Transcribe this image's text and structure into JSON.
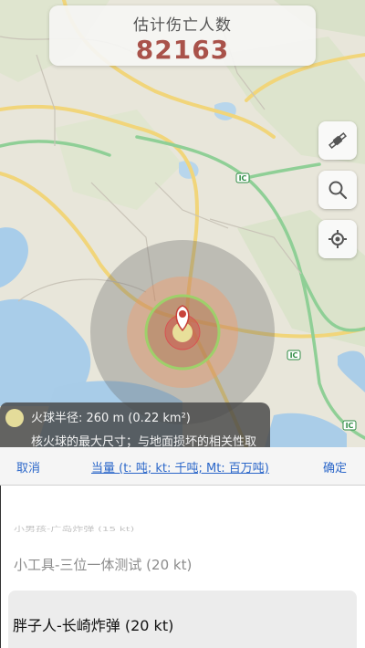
{
  "casualties": {
    "label": "估计伤亡人数",
    "value": "82163"
  },
  "map": {
    "highway_badges": [
      "IC",
      "IC",
      "IC"
    ],
    "colors": {
      "fireball": "#e4dc9a",
      "heavy_blast": "#e9a257",
      "thermal": "#ffa07a",
      "light_blast": "#8a8a8a",
      "radiation": "#9ec96a"
    }
  },
  "map_buttons": [
    "satellite-icon",
    "search-icon",
    "locate-icon"
  ],
  "info_panel": {
    "fireball_radius": "火球半径: 260 m (0.22 km²)",
    "fireball_desc": "核火球的最大尺寸；与地面损坏的相关性取"
  },
  "toolbar": {
    "cancel": "取消",
    "unit_legend": "当量 (t: 吨; kt: 千吨; Mt: 百万吨)",
    "confirm": "确定"
  },
  "picker": {
    "options": [
      {
        "label": "小男孩-广岛炸弹 (15 kt)"
      },
      {
        "label": "小工具-三位一体测试 (20 kt)"
      },
      {
        "label": "胖子人-长崎炸弹 (20 kt)"
      }
    ],
    "selected_index": 2
  }
}
